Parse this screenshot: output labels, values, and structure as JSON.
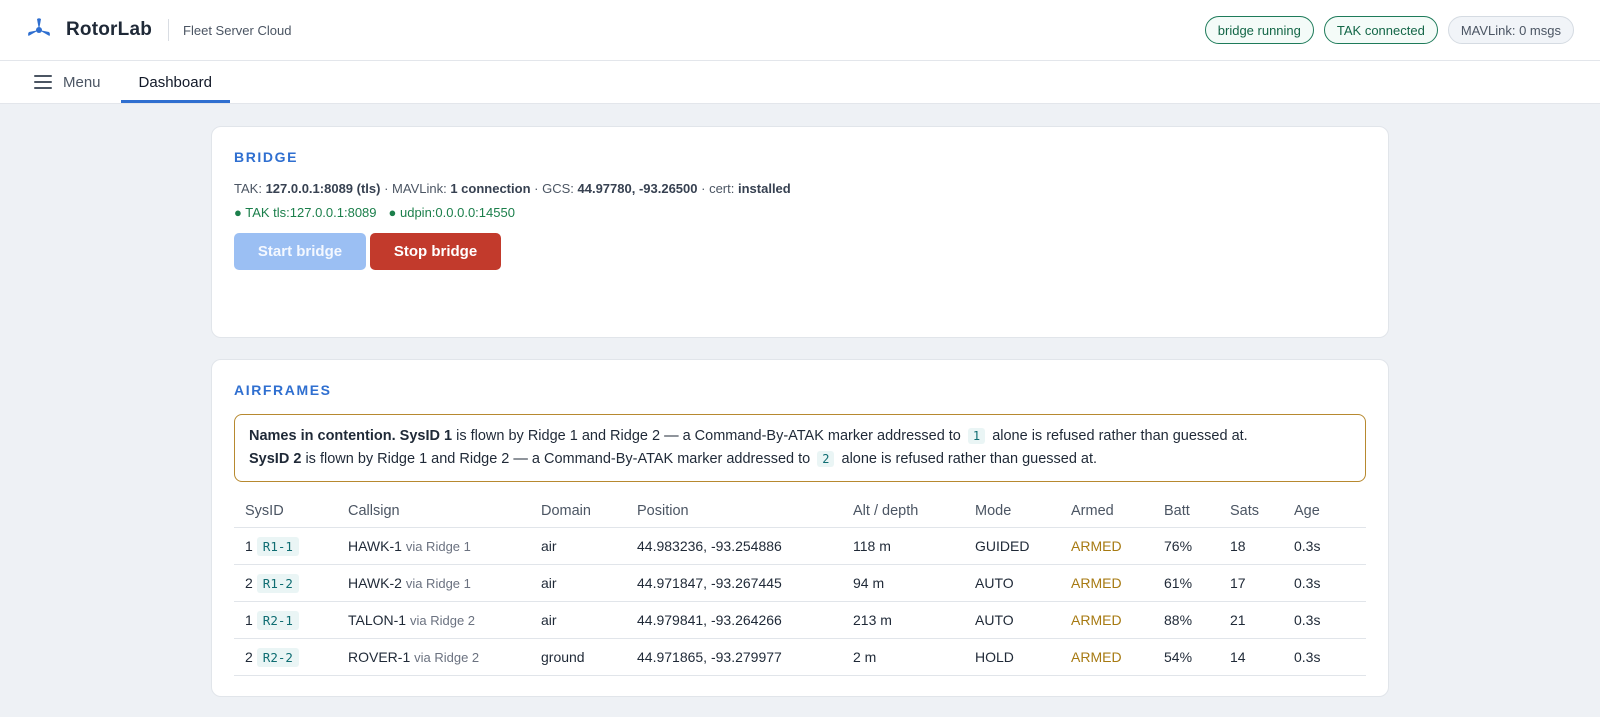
{
  "app": {
    "brand": "RotorLab",
    "subtitle": "Fleet Server Cloud",
    "status_pills": [
      {
        "label": "bridge running"
      },
      {
        "label": "TAK connected"
      },
      {
        "label": "MAVLink: 0 msgs"
      }
    ]
  },
  "nav": {
    "menu_label": "Menu",
    "tabs": [
      {
        "label": "Dashboard"
      }
    ]
  },
  "bridge": {
    "title": "Bridge",
    "tak_label": "TAK:",
    "tak_value": "127.0.0.1:8089 (tls)",
    "mavlink_label": "· MAVLink:",
    "mavlink_value": "1 connection",
    "gcs_label": "· GCS:",
    "gcs_value": "44.97780, -93.26500",
    "cert_label": "· cert:",
    "cert_value": "installed",
    "connections": [
      "● TAK tls:127.0.0.1:8089",
      "● udpin:0.0.0.0:14550"
    ],
    "start_label": "Start bridge",
    "stop_label": "Stop bridge"
  },
  "airframes": {
    "title": "Airframes",
    "warning": {
      "heading": "Names in contention.",
      "lines": [
        {
          "sysid_label": "SysID 1",
          "text_a": "is flown by Ridge 1 and Ridge 2 — a Command-By-ATAK marker addressed to",
          "code": "1",
          "text_b": "alone is refused rather than guessed at."
        },
        {
          "sysid_label": "SysID 2",
          "text_a": "is flown by Ridge 1 and Ridge 2 — a Command-By-ATAK marker addressed to",
          "code": "2",
          "text_b": "alone is refused rather than guessed at."
        }
      ]
    },
    "columns": [
      "SysID",
      "Callsign",
      "Domain",
      "Position",
      "Alt / depth",
      "Mode",
      "Armed",
      "Batt",
      "Sats",
      "Age"
    ],
    "rows": [
      {
        "sysid": "1",
        "tag": "R1-1",
        "callsign": "HAWK-1",
        "via": "via Ridge 1",
        "domain": "air",
        "position": "44.983236, -93.254886",
        "alt": "118 m",
        "mode": "GUIDED",
        "armed": "ARMED",
        "batt": "76%",
        "sats": "18",
        "age": "0.3s"
      },
      {
        "sysid": "2",
        "tag": "R1-2",
        "callsign": "HAWK-2",
        "via": "via Ridge 1",
        "domain": "air",
        "position": "44.971847, -93.267445",
        "alt": "94 m",
        "mode": "AUTO",
        "armed": "ARMED",
        "batt": "61%",
        "sats": "17",
        "age": "0.3s"
      },
      {
        "sysid": "1",
        "tag": "R2-1",
        "callsign": "TALON-1",
        "via": "via Ridge 2",
        "domain": "air",
        "position": "44.979841, -93.264266",
        "alt": "213 m",
        "mode": "AUTO",
        "armed": "ARMED",
        "batt": "88%",
        "sats": "21",
        "age": "0.3s"
      },
      {
        "sysid": "2",
        "tag": "R2-2",
        "callsign": "ROVER-1",
        "via": "via Ridge 2",
        "domain": "ground",
        "position": "44.971865, -93.279977",
        "alt": "2 m",
        "mode": "HOLD",
        "armed": "ARMED",
        "batt": "54%",
        "sats": "14",
        "age": "0.3s"
      }
    ]
  },
  "colors": {
    "accent": "#2f6fd0",
    "ok": "#1e7b5a",
    "danger": "#c23a2c",
    "warning_border": "#b7892f",
    "armed": "#a77a12"
  }
}
